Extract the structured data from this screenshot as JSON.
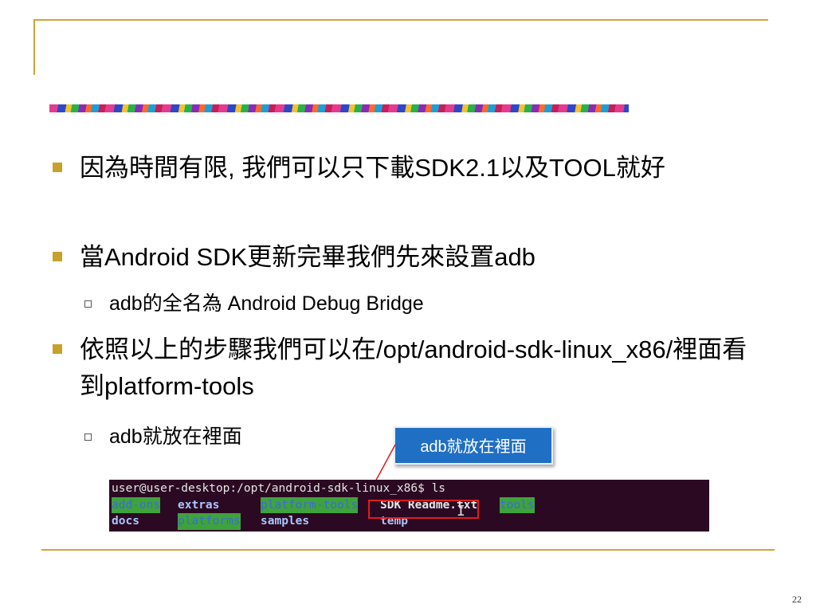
{
  "slide": {
    "bullets": [
      {
        "text": "因為時間有限, 我們可以只下載SDK2.1以及TOOL就好"
      },
      {
        "text": "當Android SDK更新完畢我們先來設置adb"
      },
      {
        "text": "adb的全名為 Android Debug Bridge"
      },
      {
        "text": "依照以上的步驟我們可以在/opt/android-sdk-linux_x86/裡面看到platform-tools"
      },
      {
        "text": "adb就放在裡面"
      }
    ],
    "callout": "adb就放在裡面",
    "page_number": "22"
  },
  "terminal": {
    "prompt": "user@user-desktop:/opt/android-sdk-linux_x86$ ls",
    "row1": [
      "add-ons",
      "extras",
      "platform-tools",
      "SDK Readme.txt",
      "tools"
    ],
    "row2": [
      "docs",
      "platforms",
      "samples",
      "temp"
    ]
  },
  "colors": {
    "frame_line": "#d4a23a",
    "bullet_square": "#c8a02a",
    "callout_bg": "#1f6fc4",
    "terminal_bg": "#2b0922",
    "highlight": "#e11b1b"
  }
}
